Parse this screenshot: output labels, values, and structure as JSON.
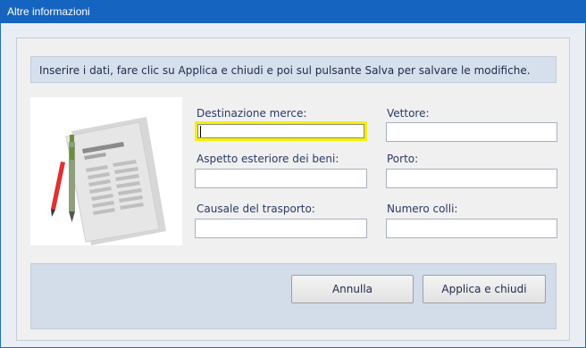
{
  "window": {
    "title": "Altre informazioni"
  },
  "info": {
    "text": "Inserire i dati, fare clic su Applica e chiudi e poi sul pulsante Salva per salvare le modifiche."
  },
  "illustration": {
    "icon": "document-with-pen-and-pencil-icon"
  },
  "form": {
    "destinazione": {
      "label": "Destinazione merce:",
      "value": ""
    },
    "vettore": {
      "label": "Vettore:",
      "value": ""
    },
    "aspetto": {
      "label": "Aspetto esteriore dei beni:",
      "value": ""
    },
    "porto": {
      "label": "Porto:",
      "value": ""
    },
    "causale": {
      "label": "Causale del trasporto:",
      "value": ""
    },
    "colli": {
      "label": "Numero colli:",
      "value": ""
    }
  },
  "buttons": {
    "cancel": "Annulla",
    "apply": "Applica e chiudi"
  },
  "colors": {
    "titlebar": "#1565c0",
    "focus_border": "#f5f000",
    "panel": "#d2dde9"
  }
}
